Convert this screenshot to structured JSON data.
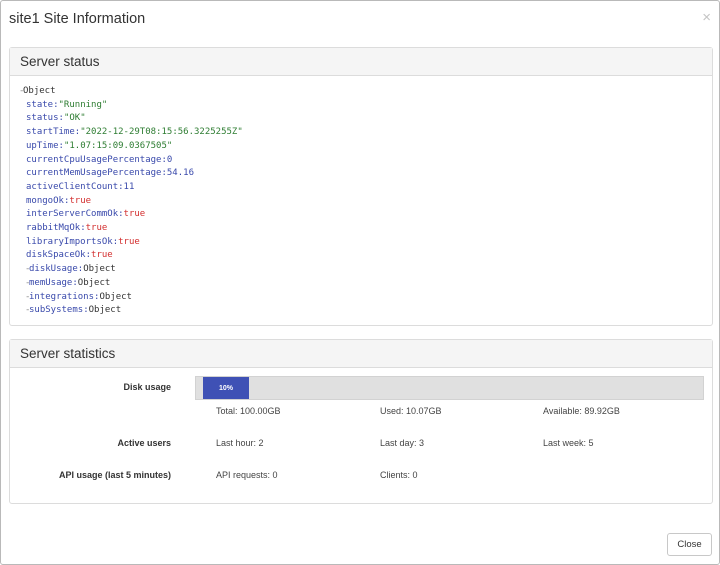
{
  "modal": {
    "title": "site1 Site Information",
    "close_glyph": "×",
    "close_button_label": "Close"
  },
  "server_status": {
    "heading": "Server status",
    "root_label": "Object",
    "toggle_glyph": "-",
    "entries": [
      {
        "key": "state",
        "value": "\"Running\"",
        "type": "string"
      },
      {
        "key": "status",
        "value": "\"OK\"",
        "type": "string"
      },
      {
        "key": "startTime",
        "value": "\"2022-12-29T08:15:56.3225255Z\"",
        "type": "string"
      },
      {
        "key": "upTime",
        "value": "\"1.07:15:09.0367505\"",
        "type": "string"
      },
      {
        "key": "currentCpuUsagePercentage",
        "value": "0",
        "type": "number"
      },
      {
        "key": "currentMemUsagePercentage",
        "value": "54.16",
        "type": "number"
      },
      {
        "key": "activeClientCount",
        "value": "11",
        "type": "number"
      },
      {
        "key": "mongoOk",
        "value": "true",
        "type": "boolean"
      },
      {
        "key": "interServerCommOk",
        "value": "true",
        "type": "boolean"
      },
      {
        "key": "rabbitMqOk",
        "value": "true",
        "type": "boolean"
      },
      {
        "key": "libraryImportsOk",
        "value": "true",
        "type": "boolean"
      },
      {
        "key": "diskSpaceOk",
        "value": "true",
        "type": "boolean"
      },
      {
        "key": "diskUsage",
        "value": "Object",
        "type": "object"
      },
      {
        "key": "memUsage",
        "value": "Object",
        "type": "object"
      },
      {
        "key": "integrations",
        "value": "Object",
        "type": "object"
      },
      {
        "key": "subSystems",
        "value": "Object",
        "type": "object"
      }
    ]
  },
  "server_statistics": {
    "heading": "Server statistics",
    "disk_usage": {
      "label": "Disk usage",
      "percent": 10,
      "percent_label": "10%",
      "total": "Total: 100.00GB",
      "used": "Used: 10.07GB",
      "available": "Available: 89.92GB"
    },
    "active_users": {
      "label": "Active users",
      "last_hour": "Last hour: 2",
      "last_day": "Last day: 3",
      "last_week": "Last week: 5"
    },
    "api_usage": {
      "label": "API usage (last 5 minutes)",
      "requests": "API requests: 0",
      "clients": "Clients: 0"
    }
  },
  "colors": {
    "progress_fill": "#3f51b5",
    "progress_track": "#e0e0e0",
    "json_key": "#3949ab",
    "json_string": "#2e7d32",
    "json_boolean": "#d32f2f"
  }
}
